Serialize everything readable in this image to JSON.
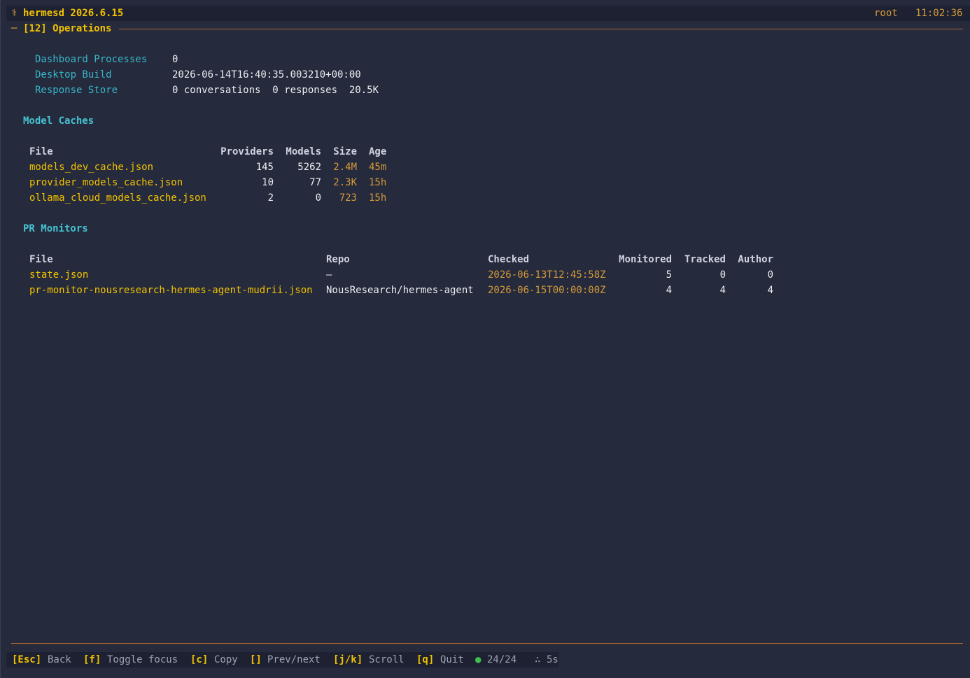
{
  "header": {
    "icon": "⚕",
    "app_title": "hermesd 2026.6.15",
    "user": "root",
    "clock": "11:02:36"
  },
  "panel": {
    "dash": "─",
    "title": "[12] Operations"
  },
  "info": [
    {
      "label": "Dashboard Processes",
      "value": "0"
    },
    {
      "label": "Desktop Build",
      "value": "2026-06-14T16:40:35.003210+00:00"
    },
    {
      "label": "Response Store",
      "value": "0 conversations  0 responses  20.5K"
    }
  ],
  "model_caches": {
    "title": "Model Caches",
    "columns": [
      "File",
      "Providers",
      "Models",
      "Size",
      "Age"
    ],
    "rows": [
      {
        "file": "models_dev_cache.json",
        "providers": "145",
        "models": "5262",
        "size": "2.4M",
        "age": "45m"
      },
      {
        "file": "provider_models_cache.json",
        "providers": "10",
        "models": "77",
        "size": "2.3K",
        "age": "15h"
      },
      {
        "file": "ollama_cloud_models_cache.json",
        "providers": "2",
        "models": "0",
        "size": "723",
        "age": "15h"
      }
    ]
  },
  "pr_monitors": {
    "title": "PR Monitors",
    "columns": [
      "File",
      "Repo",
      "Checked",
      "Monitored",
      "Tracked",
      "Author"
    ],
    "rows": [
      {
        "file": "state.json",
        "repo": "—",
        "checked": "2026-06-13T12:45:58Z",
        "monitored": "5",
        "tracked": "0",
        "author": "0"
      },
      {
        "file": "pr-monitor-nousresearch-hermes-agent-mudrii.json",
        "repo": "NousResearch/hermes-agent",
        "checked": "2026-06-15T00:00:00Z",
        "monitored": "4",
        "tracked": "4",
        "author": "4"
      }
    ]
  },
  "footer": {
    "keys": [
      {
        "key": "[Esc]",
        "label": "Back"
      },
      {
        "key": "[f]",
        "label": "Toggle focus"
      },
      {
        "key": "[c]",
        "label": "Copy"
      },
      {
        "key": "[]",
        "label": "Prev/next"
      },
      {
        "key": "[j/k]",
        "label": "Scroll"
      },
      {
        "key": "[q]",
        "label": "Quit"
      }
    ],
    "status_dot": "●",
    "status_count": "24/24",
    "refresh_icon": "∴",
    "refresh_interval": "5s"
  },
  "colors": {
    "background": "#252a3c",
    "bar": "#1d2132",
    "accent_yellow": "#f2c200",
    "accent_orange": "#d49a3b",
    "label_cyan": "#38b6c9",
    "rule": "#b76b2e",
    "status_green": "#3fbf4b"
  }
}
